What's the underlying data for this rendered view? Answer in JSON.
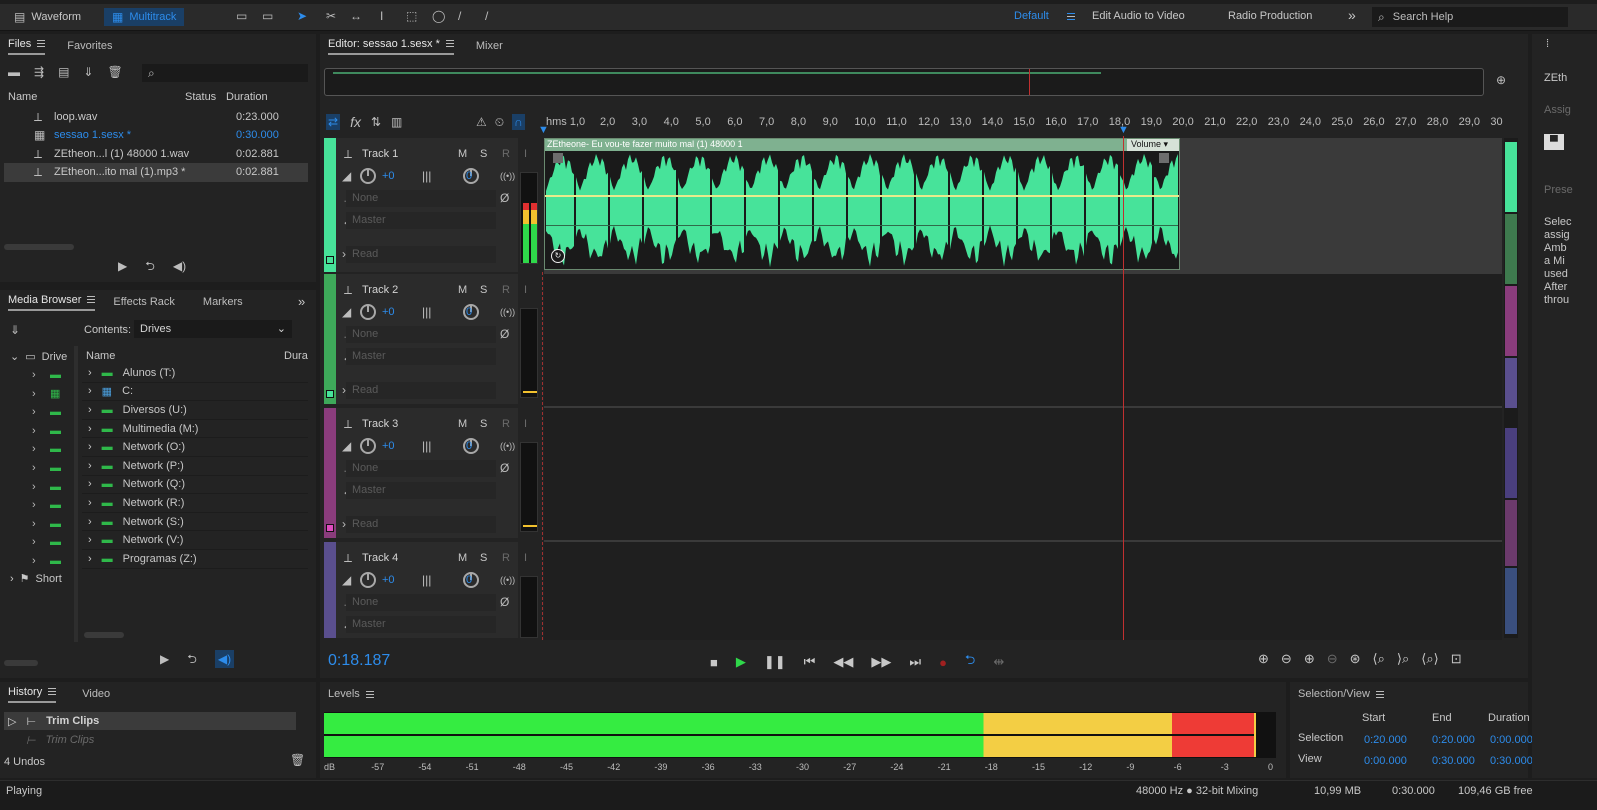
{
  "toolbar": {
    "waveform": "Waveform",
    "multitrack": "Multitrack",
    "workspace_default": "Default",
    "edit_audio": "Edit Audio to Video",
    "radio": "Radio Production",
    "more": "»",
    "search_placeholder": "Search Help"
  },
  "files": {
    "tab_files": "Files",
    "tab_favorites": "Favorites",
    "col_name": "Name",
    "col_status": "Status",
    "col_duration": "Duration",
    "items": [
      {
        "name": "loop.wav",
        "duration": "0:23.000"
      },
      {
        "name": "sessao 1.sesx *",
        "duration": "0:30.000"
      },
      {
        "name": "ZEtheon...l (1) 48000 1.wav",
        "duration": "0:02.881"
      },
      {
        "name": "ZEtheon...ito mal (1).mp3 *",
        "duration": "0:02.881"
      }
    ]
  },
  "media": {
    "tab_media": "Media Browser",
    "tab_effects": "Effects Rack",
    "tab_markers": "Markers",
    "more": "»",
    "contents_label": "Contents:",
    "contents_value": "Drives",
    "tree_drives": "Drive",
    "tree_shortcuts": "Short",
    "col_name": "Name",
    "col_dur": "Dura",
    "drives": [
      "Alunos (T:)",
      "C:",
      "Diversos (U:)",
      "Multimedia (M:)",
      "Network (O:)",
      "Network (P:)",
      "Network (Q:)",
      "Network (R:)",
      "Network (S:)",
      "Network (V:)",
      "Programas (Z:)"
    ]
  },
  "history": {
    "tab_history": "History",
    "tab_video": "Video",
    "items": [
      "Trim Clips",
      "Trim Clips"
    ],
    "undos": "4 Undos"
  },
  "editor": {
    "tab_editor": "Editor: sessao 1.sesx *",
    "tab_mixer": "Mixer",
    "time": "0:18.187",
    "ruler_first": "hms 1,0",
    "ruler": [
      "2,0",
      "3,0",
      "4,0",
      "5,0",
      "6,0",
      "7,0",
      "8,0",
      "9,0",
      "10,0",
      "11,0",
      "12,0",
      "13,0",
      "14,0",
      "15,0",
      "16,0",
      "17,0",
      "18,0",
      "19,0",
      "20,0",
      "21,0",
      "22,0",
      "23,0",
      "24,0",
      "25,0",
      "26,0",
      "27,0",
      "28,0",
      "29,0",
      "30"
    ],
    "clip_name": "ZEtheone- Eu vou-te fazer muito mal (1) 48000 1",
    "clip_volume": "Volume"
  },
  "tracks": [
    {
      "name": "Track 1",
      "vol": "+0",
      "pan": "0",
      "input": "None",
      "output": "Master",
      "mode": "Read",
      "color": "#47e39a"
    },
    {
      "name": "Track 2",
      "vol": "+0",
      "pan": "0",
      "input": "None",
      "output": "Master",
      "mode": "Read",
      "color": "#3ea95a"
    },
    {
      "name": "Track 3",
      "vol": "+0",
      "pan": "0",
      "input": "None",
      "output": "Master",
      "mode": "Read",
      "color": "#e04bc0"
    },
    {
      "name": "Track 4",
      "vol": "+0",
      "pan": "0",
      "input": "None",
      "output": "Master",
      "color": "#6458a8"
    }
  ],
  "track_buttons": {
    "m": "M",
    "s": "S",
    "r": "R",
    "i": "I"
  },
  "levels": {
    "title": "Levels",
    "scale": [
      "dB",
      "-57",
      "-54",
      "-51",
      "-48",
      "-45",
      "-42",
      "-39",
      "-36",
      "-33",
      "-30",
      "-27",
      "-24",
      "-21",
      "-18",
      "-15",
      "-12",
      "-9",
      "-6",
      "-3",
      "0"
    ]
  },
  "selection": {
    "title": "Selection/View",
    "col_start": "Start",
    "col_end": "End",
    "col_duration": "Duration",
    "row_selection": "Selection",
    "row_view": "View",
    "sel_start": "0:20.000",
    "sel_end": "0:20.000",
    "sel_dur": "0:00.000",
    "view_start": "0:00.000",
    "view_end": "0:30.000",
    "view_dur": "0:30.000"
  },
  "status": {
    "left": "Playing",
    "format": "48000 Hz ● 32-bit Mixing",
    "size": "10,99 MB",
    "duration": "0:30.000",
    "free": "109,46 GB free"
  },
  "right": {
    "a": "ZEth",
    "b": "Assig",
    "c": "Prese",
    "d": [
      "Selec",
      "assig",
      "Amb",
      "a Mi",
      "used",
      "After",
      "throu"
    ]
  }
}
